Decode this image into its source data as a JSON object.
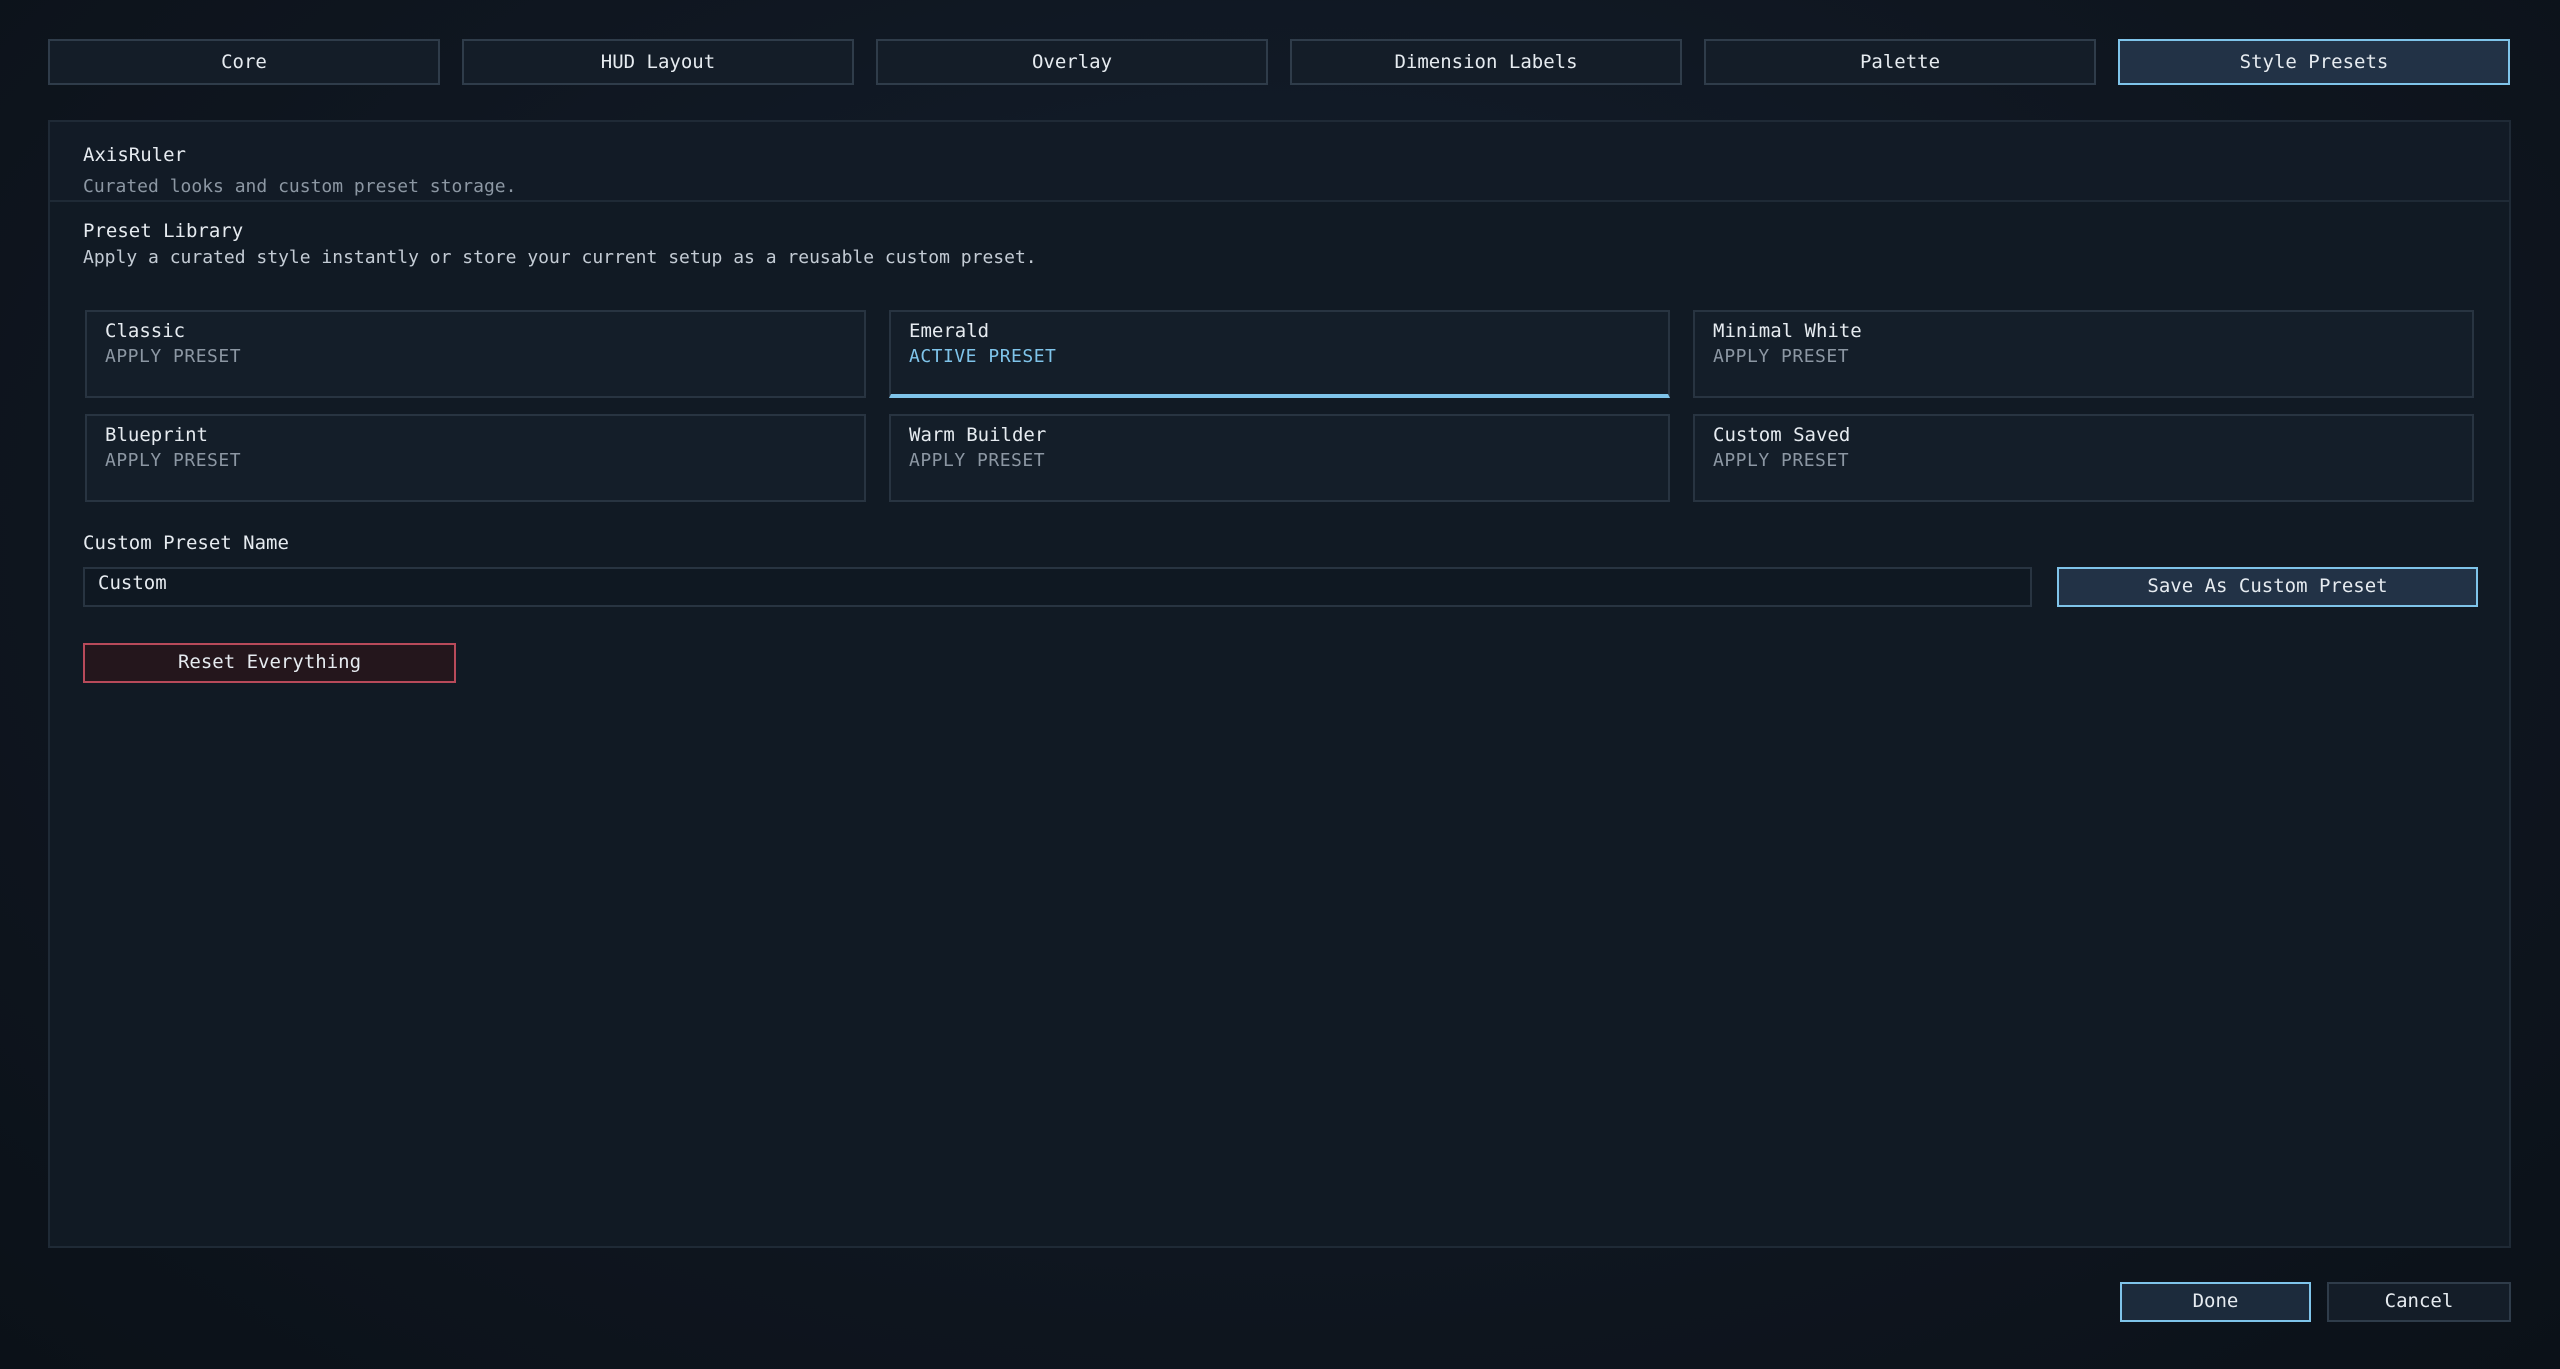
{
  "tabs": [
    {
      "label": "Core",
      "active": false
    },
    {
      "label": "HUD Layout",
      "active": false
    },
    {
      "label": "Overlay",
      "active": false
    },
    {
      "label": "Dimension Labels",
      "active": false
    },
    {
      "label": "Palette",
      "active": false
    },
    {
      "label": "Style Presets",
      "active": true
    }
  ],
  "header": {
    "title": "AxisRuler",
    "subtitle": "Curated looks and custom preset storage."
  },
  "section": {
    "title": "Preset Library",
    "description": "Apply a curated style instantly or store your current setup as a reusable custom preset."
  },
  "presets": [
    {
      "name": "Classic",
      "action": "APPLY PRESET"
    },
    {
      "name": "Emerald",
      "action": "ACTIVE PRESET"
    },
    {
      "name": "Minimal White",
      "action": "APPLY PRESET"
    },
    {
      "name": "Blueprint",
      "action": "APPLY PRESET"
    },
    {
      "name": "Warm Builder",
      "action": "APPLY PRESET"
    },
    {
      "name": "Custom Saved",
      "action": "APPLY PRESET"
    }
  ],
  "custom_preset": {
    "label": "Custom Preset Name",
    "value": "Custom",
    "save_label": "Save As Custom Preset"
  },
  "reset_label": "Reset Everything",
  "footer": {
    "done_label": "Done",
    "cancel_label": "Cancel"
  },
  "colors": {
    "accent": "#7fc4ea",
    "danger": "#b84a5a",
    "background": "#0f1620"
  }
}
